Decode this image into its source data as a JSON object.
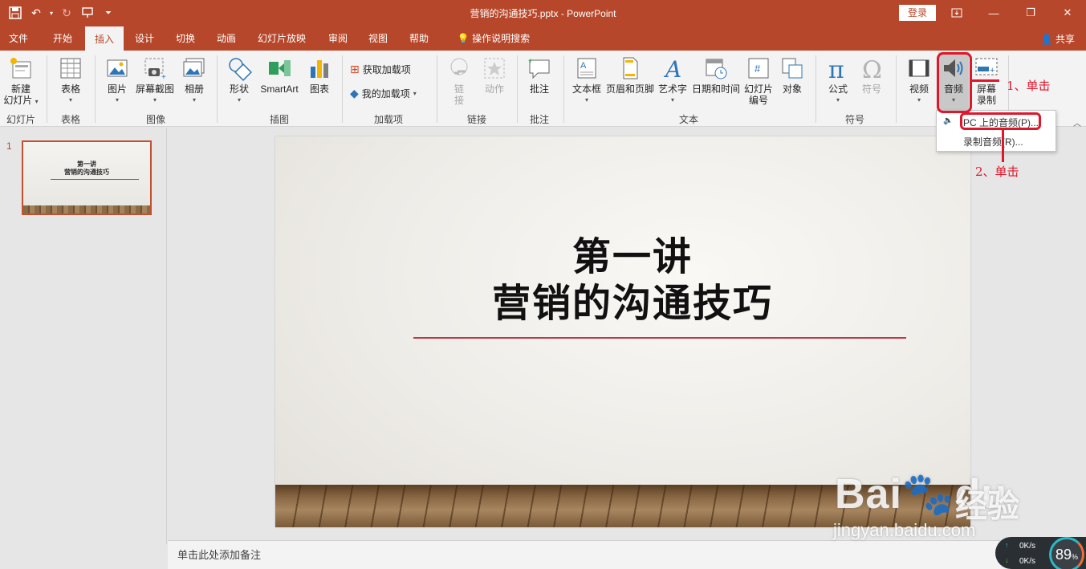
{
  "title_bar": {
    "doc_title": "营销的沟通技巧.pptx - PowerPoint",
    "login_label": "登录",
    "qat_icons": [
      "save-icon",
      "undo-icon",
      "redo-icon",
      "present-icon",
      "customize-icon"
    ],
    "window_controls": [
      "ribbon-display-icon",
      "minimize-icon",
      "restore-icon",
      "close-icon"
    ]
  },
  "tabs": [
    "文件",
    "开始",
    "插入",
    "设计",
    "切换",
    "动画",
    "幻灯片放映",
    "审阅",
    "视图",
    "帮助"
  ],
  "active_tab": "插入",
  "tell_me": "操作说明搜索",
  "share": "共享",
  "ribbon": {
    "slides": {
      "new_slide": "新建\n幻灯片",
      "new_slide_l1": "新建",
      "new_slide_l2": "幻灯片",
      "group": "幻灯片"
    },
    "tables": {
      "table": "表格",
      "group": "表格"
    },
    "images": {
      "picture": "图片",
      "screenshot": "屏幕截图",
      "album": "相册",
      "group": "图像"
    },
    "illustrations": {
      "shapes": "形状",
      "smartart": "SmartArt",
      "chart": "图表",
      "group": "插图"
    },
    "addins": {
      "get": "获取加载项",
      "mine": "我的加载项",
      "group": "加载项"
    },
    "links": {
      "link_l1": "链",
      "link_l2": "接",
      "action": "动作",
      "group": "链接"
    },
    "comments": {
      "comment": "批注",
      "group": "批注"
    },
    "text": {
      "textbox": "文本框",
      "header_footer": "页眉和页脚",
      "wordart": "艺术字",
      "datetime": "日期和时间",
      "slide_no_l1": "幻灯片",
      "slide_no_l2": "编号",
      "object": "对象",
      "group": "文本"
    },
    "symbols": {
      "equation": "公式",
      "symbol": "符号",
      "group": "符号"
    },
    "media": {
      "video": "视频",
      "audio": "音频",
      "screen_rec_l1": "屏幕",
      "screen_rec_l2": "录制"
    }
  },
  "audio_menu": {
    "items": [
      "PC 上的音频(P)...",
      "录制音频(R)..."
    ]
  },
  "slide_pane": {
    "slide_number": "1",
    "thumb_title": "第一讲",
    "thumb_subtitle": "营销的沟通技巧"
  },
  "slide": {
    "title": "第一讲",
    "subtitle": "营销的沟通技巧"
  },
  "notes_placeholder": "单击此处添加备注",
  "annotations": {
    "step1": "1、单击",
    "step2": "2、单击"
  },
  "watermark": {
    "brand": "Bai",
    "brand2": "du",
    "cn": "经验",
    "url": "jingyan.baidu.com"
  },
  "net_monitor": {
    "up": "0K/s",
    "down": "0K/s",
    "percent": "89",
    "unit": "%"
  },
  "colors": {
    "accent": "#b7472a",
    "annotation": "#e0162b",
    "title_rule": "#c0374a"
  }
}
